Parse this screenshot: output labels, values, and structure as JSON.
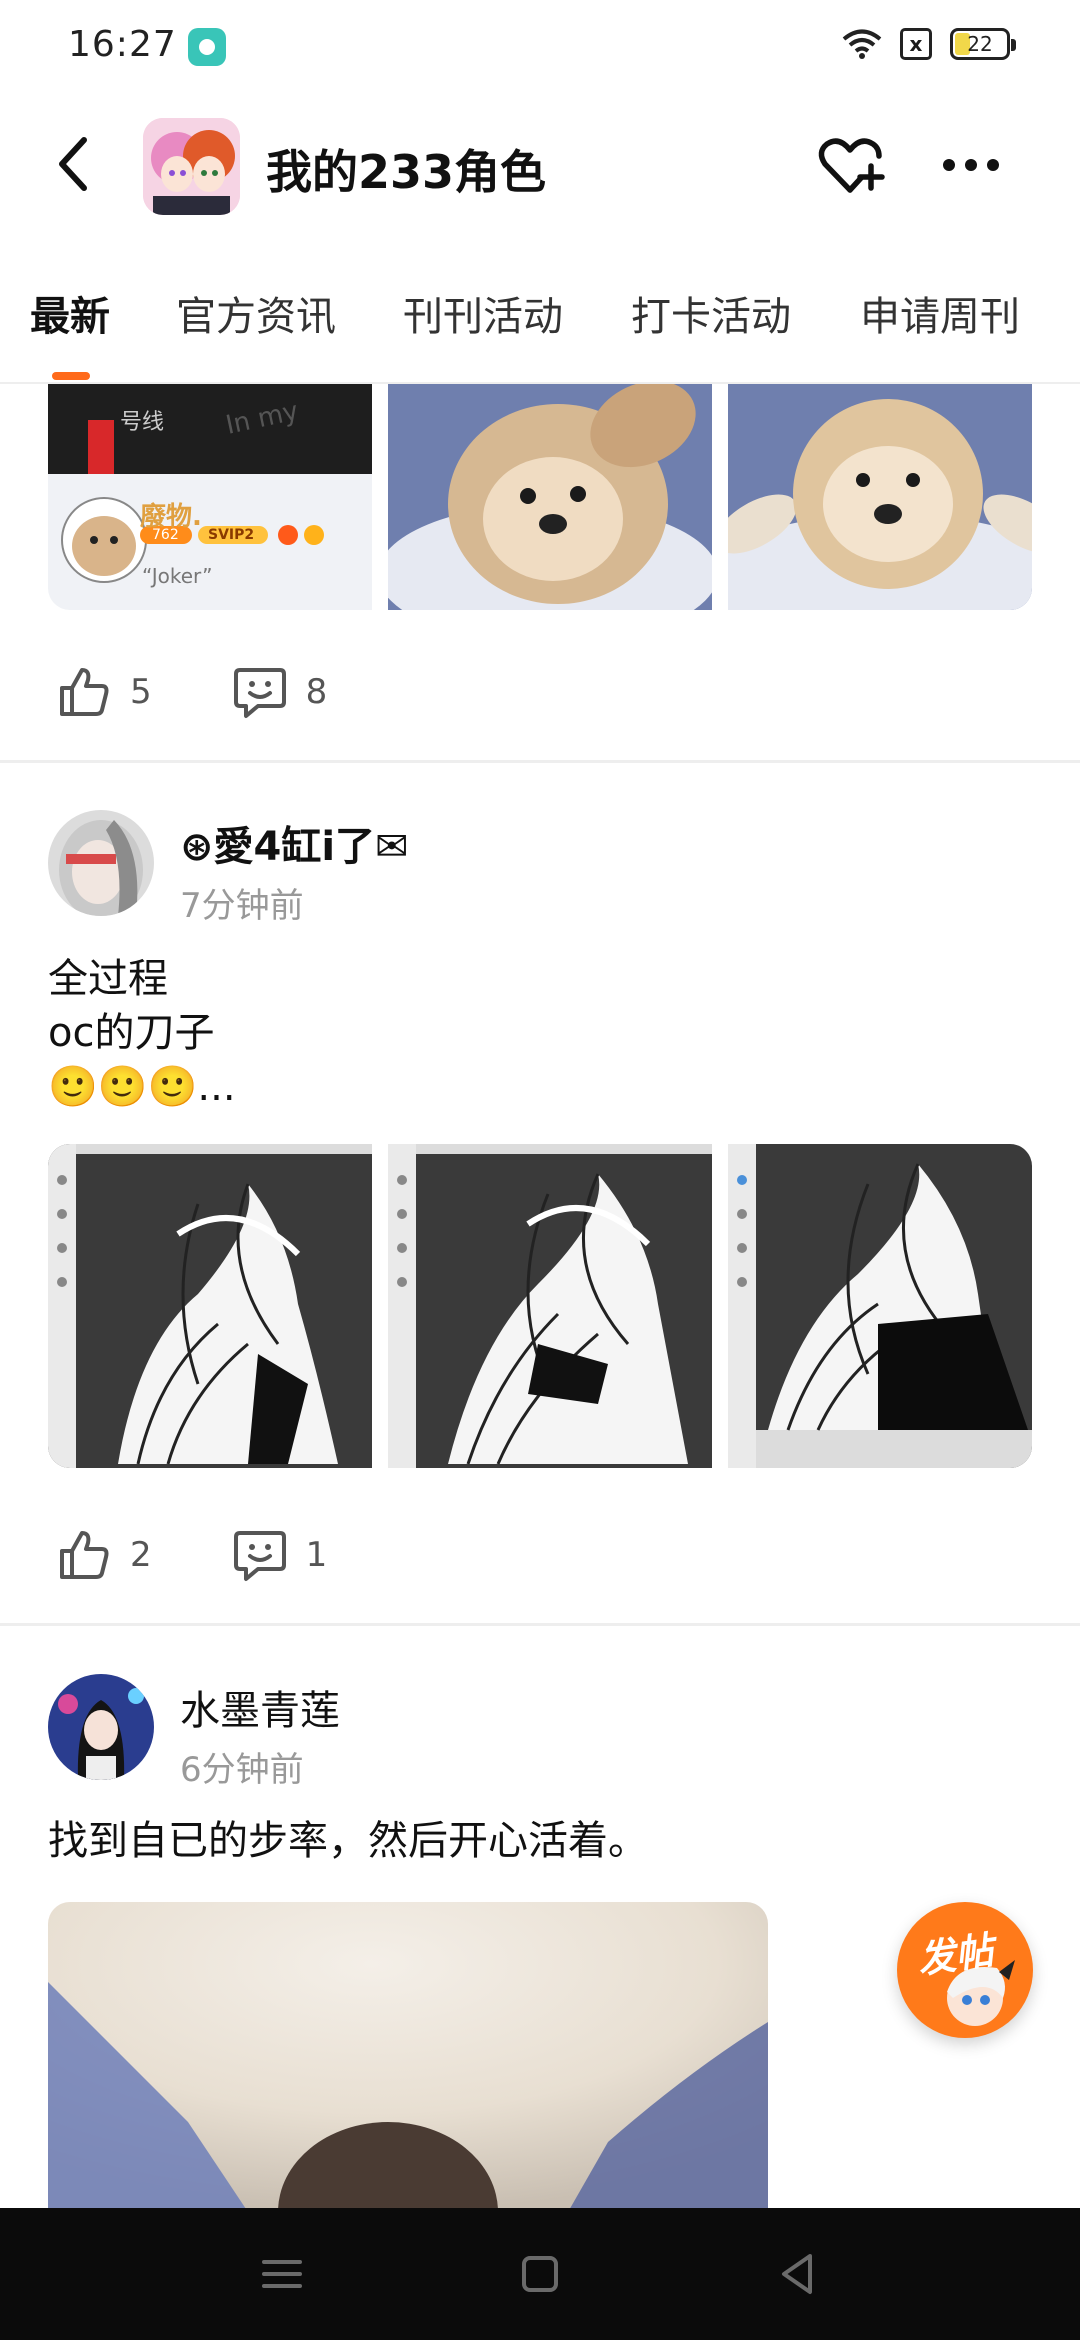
{
  "status_bar": {
    "time": "16:27",
    "battery": "22",
    "sim_icon": "x"
  },
  "header": {
    "title": "我的233角色"
  },
  "tabs": [
    {
      "label": "最新",
      "active": true
    },
    {
      "label": "官方资讯",
      "active": false
    },
    {
      "label": "刊刊活动",
      "active": false
    },
    {
      "label": "打卡活动",
      "active": false
    },
    {
      "label": "申请周刊",
      "active": false
    }
  ],
  "posts": [
    {
      "images": [
        "screenshot-card",
        "puppy-photo",
        "puppy-photo"
      ],
      "card": {
        "sign_text": "号线",
        "name": "廢物.",
        "badge_level": "762",
        "badge_vip": "SVIP2",
        "caption": "“Joker”"
      },
      "likes": "5",
      "comments": "8"
    },
    {
      "username": "⊛愛4缸i了✉",
      "time": "7分钟前",
      "text": "全过程\noc的刀子\n🙂🙂🙂...",
      "images": [
        "lineart-drawing",
        "lineart-drawing",
        "lineart-drawing"
      ],
      "likes": "2",
      "comments": "1"
    },
    {
      "username": "水墨青莲",
      "time": "6分钟前",
      "text": "找到自已的步率，然后开心活着。",
      "images": [
        "blurred-photo"
      ]
    }
  ],
  "fab": {
    "label": "发帖"
  },
  "colors": {
    "accent": "#ff6a1a",
    "fab": "#ff7a1a",
    "muted": "#999999",
    "divider": "#eeeeee"
  },
  "icons": [
    "back-arrow-icon",
    "follow-heart-icon",
    "more-dots-icon",
    "like-icon",
    "comment-icon",
    "menu-icon",
    "home-icon",
    "back-triangle-icon",
    "wifi-icon"
  ]
}
